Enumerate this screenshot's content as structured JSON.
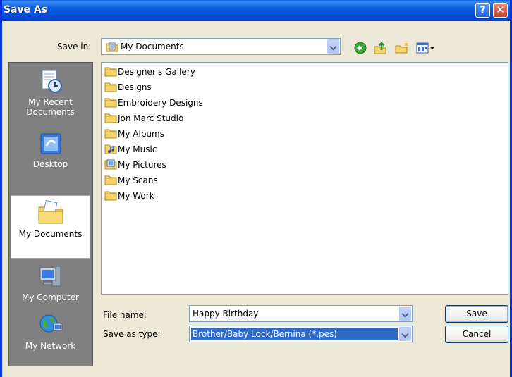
{
  "window": {
    "title": "Save As"
  },
  "title_buttons": {
    "help": "?",
    "close": "✕"
  },
  "save_in": {
    "label": "Save in:",
    "value": "My Documents"
  },
  "places": [
    {
      "label": "My Recent Documents",
      "icon": "recent-documents-icon"
    },
    {
      "label": "Desktop",
      "icon": "desktop-icon"
    },
    {
      "label": "My Documents",
      "icon": "my-documents-icon",
      "selected": true
    },
    {
      "label": "My Computer",
      "icon": "my-computer-icon"
    },
    {
      "label": "My Network",
      "icon": "my-network-icon"
    }
  ],
  "files": [
    {
      "name": "Designer's Gallery",
      "icon": "folder-icon"
    },
    {
      "name": "Designs",
      "icon": "folder-icon"
    },
    {
      "name": "Embroidery Designs",
      "icon": "folder-icon"
    },
    {
      "name": "Jon Marc Studio",
      "icon": "folder-icon"
    },
    {
      "name": "My Albums",
      "icon": "folder-icon"
    },
    {
      "name": "My Music",
      "icon": "music-folder-icon"
    },
    {
      "name": "My Pictures",
      "icon": "pictures-folder-icon"
    },
    {
      "name": "My Scans",
      "icon": "folder-icon"
    },
    {
      "name": "My Work",
      "icon": "folder-icon"
    }
  ],
  "file_name": {
    "label": "File name:",
    "value": "Happy Birthday"
  },
  "save_as_type": {
    "label": "Save as type:",
    "value": "Brother/Baby Lock/Bernina (*.pes)"
  },
  "buttons": {
    "save": "Save",
    "cancel": "Cancel"
  },
  "colors": {
    "title_bar": "#0a5ce0",
    "window_bg": "#ece9d8",
    "places_bg": "#808080",
    "selection": "#316ac5"
  }
}
